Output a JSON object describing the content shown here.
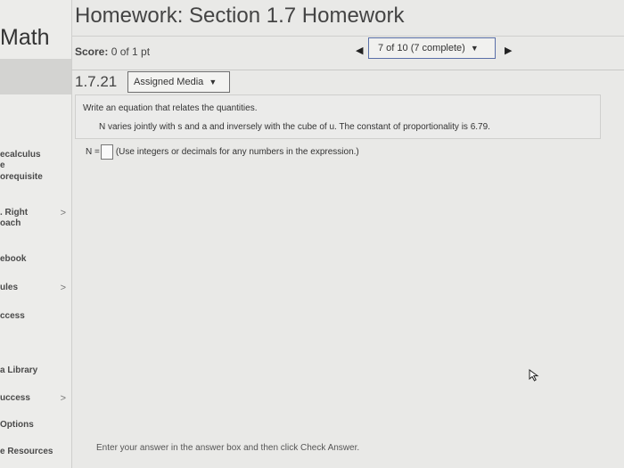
{
  "sidebar": {
    "brand": "Math",
    "items": [
      {
        "label": "ecalculus",
        "chevron": false
      },
      {
        "label": "e",
        "chevron": false
      },
      {
        "label": "orequisite",
        "chevron": false
      },
      {
        "label": ". Right",
        "chevron": true
      },
      {
        "label": "oach",
        "chevron": false
      },
      {
        "label": "ebook",
        "chevron": false
      },
      {
        "label": "ules",
        "chevron": true
      },
      {
        "label": "ccess",
        "chevron": false
      },
      {
        "label": "a Library",
        "chevron": false
      },
      {
        "label": "uccess",
        "chevron": true
      },
      {
        "label": "Options",
        "chevron": false
      },
      {
        "label": "e Resources",
        "chevron": false
      }
    ],
    "chevron_glyph": ">"
  },
  "header": {
    "title": "Homework: Section 1.7 Homework",
    "score_label": "Score:",
    "score_value": "0 of 1 pt",
    "progress": "7 of 10 (7 complete)"
  },
  "question": {
    "number": "1.7.21",
    "media_label": "Assigned Media",
    "instruction": "Write an equation that relates the quantities.",
    "text": "N varies jointly with s and a and inversely with the cube of u. The constant of proportionality is 6.79.",
    "answer_prefix": "N =",
    "answer_hint": "(Use integers or decimals for any numbers in the expression.)"
  },
  "footer": {
    "hint": "Enter your answer in the answer box and then click Check Answer."
  }
}
